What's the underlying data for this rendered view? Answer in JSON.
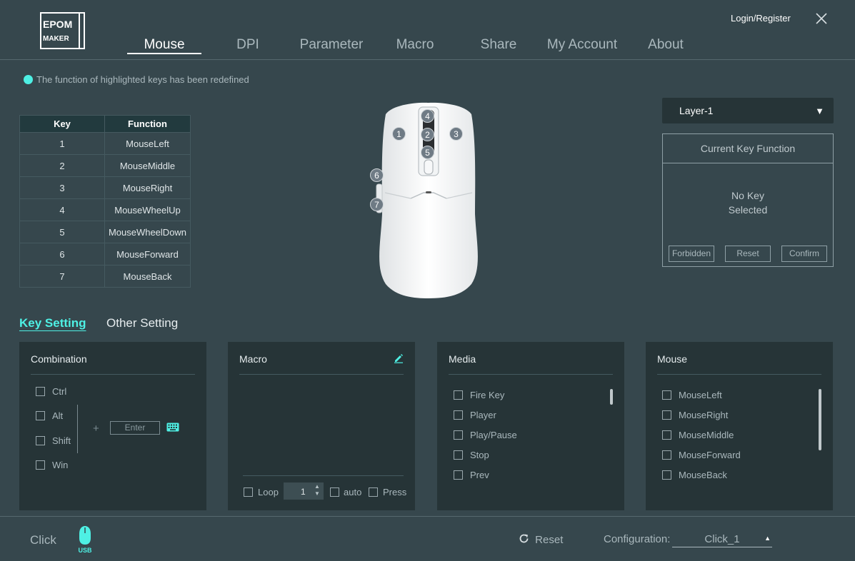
{
  "header": {
    "brand": "EPOMAKER",
    "tabs": [
      {
        "label": "Mouse",
        "active": true
      },
      {
        "label": "DPI"
      },
      {
        "label": "Parameter"
      },
      {
        "label": "Macro"
      },
      {
        "label": "Share"
      },
      {
        "label": "My Account"
      },
      {
        "label": "About"
      }
    ],
    "login_label": "Login/Register"
  },
  "hint": "The function of highlighted keys has been redefined",
  "key_table": {
    "headers": [
      "Key",
      "Function"
    ],
    "rows": [
      [
        "1",
        "MouseLeft"
      ],
      [
        "2",
        "MouseMiddle"
      ],
      [
        "3",
        "MouseRight"
      ],
      [
        "4",
        "MouseWheelUp"
      ],
      [
        "5",
        "MouseWheelDown"
      ],
      [
        "6",
        "MouseForward"
      ],
      [
        "7",
        "MouseBack"
      ]
    ]
  },
  "mouse_badges": [
    "1",
    "2",
    "3",
    "4",
    "5",
    "6",
    "7"
  ],
  "layer": {
    "selected": "Layer-1"
  },
  "current_key": {
    "title": "Current Key Function",
    "empty_line1": "No Key",
    "empty_line2": "Selected",
    "buttons": [
      "Forbidden",
      "Reset",
      "Confirm"
    ]
  },
  "subtabs": {
    "active": "Key Setting",
    "other": "Other Setting"
  },
  "combination": {
    "title": "Combination",
    "modifiers": [
      "Ctrl",
      "Alt",
      "Shift",
      "Win"
    ],
    "plus": "+",
    "key_placeholder": "Enter"
  },
  "macro": {
    "title": "Macro",
    "loop_label": "Loop",
    "loop_count": "1",
    "auto_label": "auto",
    "press_label": "Press"
  },
  "media": {
    "title": "Media",
    "items": [
      "Fire Key",
      "Player",
      "Play/Pause",
      "Stop",
      "Prev"
    ]
  },
  "mouse_panel": {
    "title": "Mouse",
    "items": [
      "MouseLeft",
      "MouseRight",
      "MouseMiddle",
      "MouseForward",
      "MouseBack"
    ]
  },
  "footer": {
    "device_name": "Click",
    "connection": "USB",
    "reset_label": "Reset",
    "config_label": "Configuration:",
    "config_value": "Click_1"
  },
  "colors": {
    "accent": "#4ef0e4",
    "background": "#36474d",
    "panel": "#263437"
  }
}
